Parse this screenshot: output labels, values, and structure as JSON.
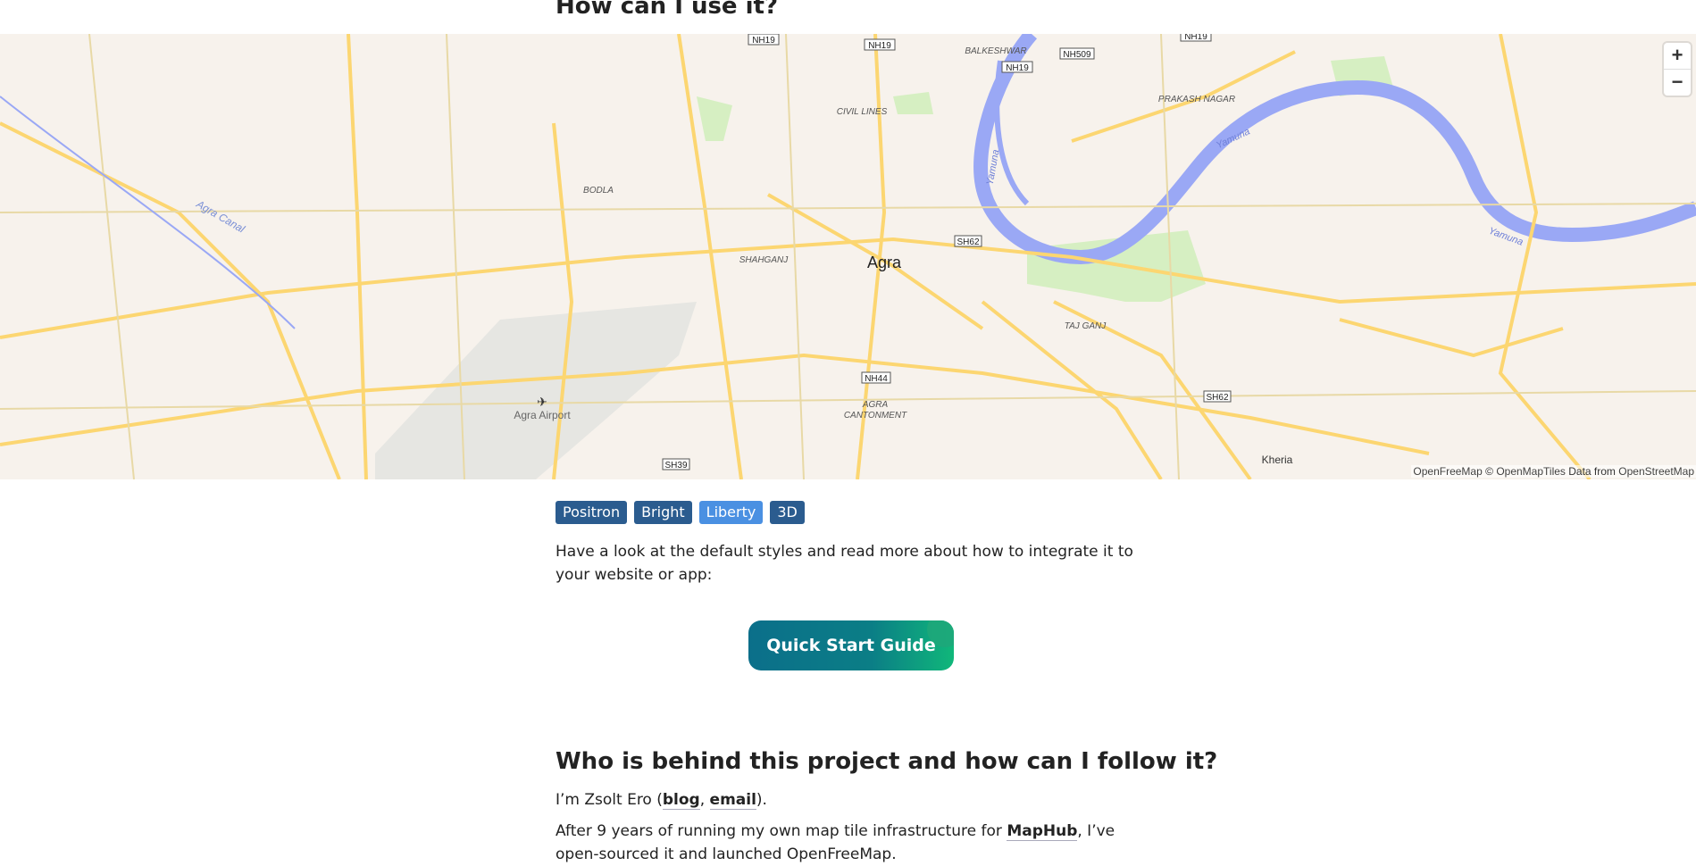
{
  "headings": {
    "top": "How can I use it?",
    "who": "Who is behind this project and how can I follow it?"
  },
  "map": {
    "zoom_in": "+",
    "zoom_out": "−",
    "labels": {
      "city": "Agra",
      "civil_lines": "CIVIL LINES",
      "balkeshwar": "BALKESHWAR",
      "prakash_nagar": "PRAKASH NAGAR",
      "bodla": "BODLA",
      "shahganj": "SHAHGANJ",
      "taj_ganj": "TAJ GANJ",
      "agra_cantonment_1": "AGRA",
      "agra_cantonment_2": "CANTONMENT",
      "agra_airport": "Agra Airport",
      "kheria": "Kheria",
      "agra_canal": "Agra Canal",
      "yamuna_1": "Yamuna",
      "yamuna_2": "Yamuna",
      "yamuna_3": "Yamuna"
    },
    "shields": {
      "nh19_a": "NH19",
      "nh19_b": "NH19",
      "nh19_c": "NH19",
      "nh19_d": "NH19",
      "nh509": "NH509",
      "sh62_a": "SH62",
      "sh62_b": "SH62",
      "nh44": "NH44",
      "sh39": "SH39"
    },
    "attribution": {
      "openfreemap": "OpenFreeMap",
      "copy": "©",
      "openmaptiles": "OpenMapTiles",
      "data_from": "Data from",
      "osm": "OpenStreetMap"
    },
    "colors": {
      "land": "#f7f2ec",
      "water": "#9aa8f5",
      "road": "#fcd671",
      "park": "#d6efc2"
    }
  },
  "styles": {
    "buttons": [
      "Positron",
      "Bright",
      "Liberty",
      "3D"
    ],
    "active": "Liberty"
  },
  "intro": "Have a look at the default styles and read more about how to integrate it to your website or app:",
  "quick_start": "Quick Start Guide",
  "me": {
    "prefix": "I’m Zsolt Ero (",
    "blog": "blog",
    "sep": ", ",
    "email": "email",
    "suffix": ")."
  },
  "after": {
    "prefix": "After 9 years of running my own map tile infrastructure for ",
    "maphub": "MapHub",
    "suffix": ", I’ve open-sourced it and launched OpenFreeMap."
  }
}
